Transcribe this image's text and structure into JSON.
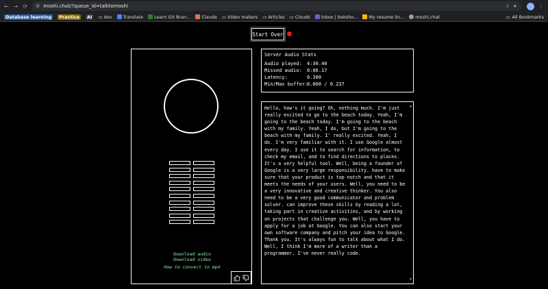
{
  "browser": {
    "url": "moshi.chat/?queue_id=talktomoshi",
    "bookmarks": [
      {
        "label": "Database learning",
        "kind": "tag-db"
      },
      {
        "label": "Practice",
        "kind": "tag-pr"
      },
      {
        "label": "AI",
        "kind": "tag-ai"
      },
      {
        "label": "dev",
        "kind": "folder"
      },
      {
        "label": "Translate",
        "kind": "fav",
        "color": "#4285f4"
      },
      {
        "label": "Learn Git Bran...",
        "kind": "fav",
        "color": "#2e7d32"
      },
      {
        "label": "Claude",
        "kind": "fav",
        "color": "#d97757"
      },
      {
        "label": "Video makers",
        "kind": "folder"
      },
      {
        "label": "Articles",
        "kind": "folder"
      },
      {
        "label": "Clouds",
        "kind": "folder"
      },
      {
        "label": "Inbox | beksho...",
        "kind": "fav",
        "color": "#7e57c2"
      },
      {
        "label": "My resume lin...",
        "kind": "fav",
        "color": "#fbbc04"
      },
      {
        "label": "moshi.chat",
        "kind": "fav",
        "color": "#9e9e9e"
      }
    ],
    "all_bookmarks": "All Bookmarks"
  },
  "controls": {
    "start_over": "Start Over",
    "record_color": "#e11d21"
  },
  "downloads": {
    "audio": "Download audio",
    "video": "Download video",
    "convert": "How to convert to mp4",
    "link_color": "#86efac"
  },
  "stats": {
    "title": "Server Audio Stats",
    "rows": [
      {
        "key": "Audio played:",
        "value": "4:30.40"
      },
      {
        "key": "Missed audio:",
        "value": "0:06.17"
      },
      {
        "key": "Latency:",
        "value": "0.380"
      },
      {
        "key": "Min/Max buffer:",
        "value": "0.000 / 0.237"
      }
    ]
  },
  "transcript": "Hello, how's it going? Oh, nothing much. I'm just really excited to go to the beach today. Yeah, I'm going to the beach today. I'm going to the beach with my family. Yeah, I do, but I'm going to the beach with my family. I' really excited. Yeah, I do. I'm very familiar with it. I use Google almost every day. I use it to search for information, to check my email, and to find directions to places. It's a very helpful tool. Well, being a founder of Google is a very large responsibility. have to make sure that your product is top notch and that it meets the needs of your users. Well, you need to be a very innovative and creative thinker. You also need to be a very good communicator and problem solver. can improve these skills by reading a lot, taking part in creative activities, and by working on projects that challenge you. Well, you have to apply for a job at Google. You can also start your own software company and pitch your idea to Google. Thank you. It's always fun to talk about what I do. Well, I think I'm more of a writer than a programmer. I've never really code."
}
